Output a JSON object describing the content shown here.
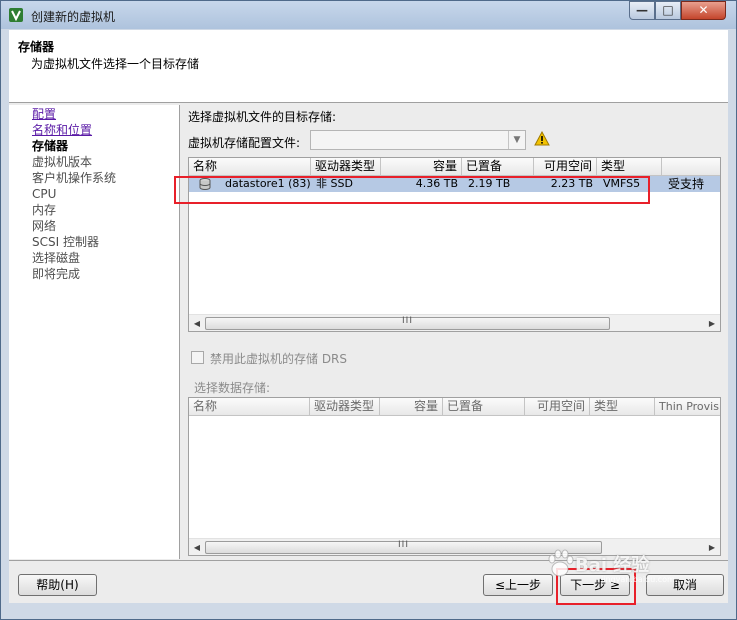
{
  "window": {
    "title": "创建新的虚拟机",
    "controls": {
      "minimize": "—",
      "maximize": "□",
      "close": "✕"
    },
    "app_icon": "vsphere-icon"
  },
  "header": {
    "title": "存储器",
    "subtitle": "为虚拟机文件选择一个目标存储"
  },
  "nav": {
    "items": [
      {
        "label": "配置",
        "state": "link"
      },
      {
        "label": "名称和位置",
        "state": "link"
      },
      {
        "label": "存储器",
        "state": "current"
      },
      {
        "label": "虚拟机版本",
        "state": "disabled"
      },
      {
        "label": "客户机操作系统",
        "state": "disabled"
      },
      {
        "label": "CPU",
        "state": "disabled"
      },
      {
        "label": "内存",
        "state": "disabled"
      },
      {
        "label": "网络",
        "state": "disabled"
      },
      {
        "label": "SCSI 控制器",
        "state": "disabled"
      },
      {
        "label": "选择磁盘",
        "state": "disabled"
      },
      {
        "label": "即将完成",
        "state": "disabled"
      }
    ]
  },
  "main": {
    "section_label": "选择虚拟机文件的目标存储:",
    "profile_label": "虚拟机存储配置文件:",
    "profile_value": "",
    "warning_icon": "warning-icon",
    "table1": {
      "columns": [
        "名称",
        "驱动器类型",
        "容量",
        "已置备",
        "可用空间",
        "类型",
        ""
      ],
      "rows": [
        {
          "name": "datastore1 (83)",
          "drive_type": "非 SSD",
          "capacity": "4.36 TB",
          "provisioned": "2.19 TB",
          "free": "2.23 TB",
          "type": "VMFS5",
          "extra": "受支持"
        }
      ]
    },
    "disable_drs_label": "禁用此虚拟机的存储 DRS",
    "select_datastore_label": "选择数据存储:",
    "table2": {
      "columns": [
        "名称",
        "驱动器类型",
        "容量",
        "已置备",
        "可用空间",
        "类型",
        "Thin Provisi"
      ]
    },
    "scroll_grip": "III"
  },
  "footer": {
    "help": "帮助(H)",
    "back": "≤上一步",
    "next": "下一步 ≥",
    "cancel": "取消"
  },
  "watermark": {
    "text": "Bai 经验",
    "sub": "jingyan.baidu.com"
  },
  "colors": {
    "highlight": "#e8202a",
    "selected_row": "#b6c9e4",
    "link": "#5a1aa6"
  }
}
